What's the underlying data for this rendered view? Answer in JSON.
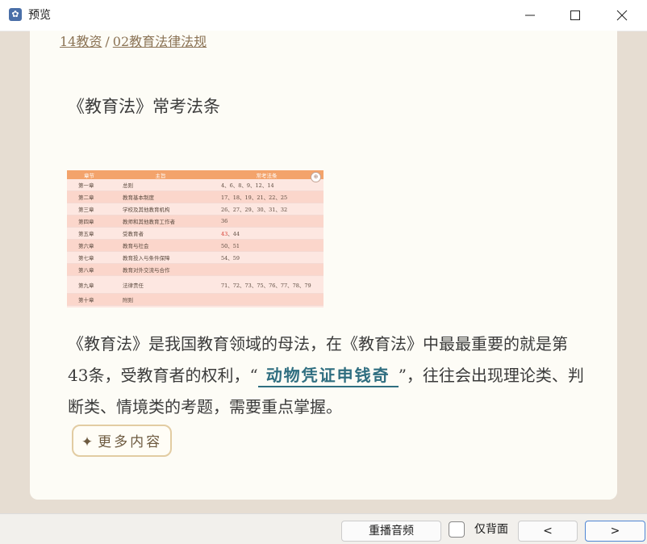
{
  "window": {
    "title": "预览",
    "icon": "app-icon"
  },
  "breadcrumb": {
    "parent": "14教资",
    "separator": "/",
    "current": "02教育法律法规"
  },
  "heading": "《教育法》常考法条",
  "table": {
    "headers": [
      "章节",
      "主旨",
      "常考法条"
    ],
    "rows": [
      {
        "chapter": "第一章",
        "topic": "总则",
        "articles": "4、6、8、9、12、14"
      },
      {
        "chapter": "第二章",
        "topic": "教育基本制度",
        "articles": "17、18、19、21、22、25"
      },
      {
        "chapter": "第三章",
        "topic": "学校及其他教育机构",
        "articles": "26、27、29、30、31、32"
      },
      {
        "chapter": "第四章",
        "topic": "教师和其他教育工作者",
        "articles": "36"
      },
      {
        "chapter": "第五章",
        "topic": "受教育者",
        "articles_highlight": "43",
        "articles_rest": "、44"
      },
      {
        "chapter": "第六章",
        "topic": "教育与社会",
        "articles": "50、51"
      },
      {
        "chapter": "第七章",
        "topic": "教育投入与条件保障",
        "articles": "54、59"
      },
      {
        "chapter": "第八章",
        "topic": "教育对外交流与合作",
        "articles": ""
      },
      {
        "chapter": "第九章",
        "topic": "法律责任",
        "articles": "71、72、73、75、76、77、78、79"
      },
      {
        "chapter": "第十章",
        "topic": "附则",
        "articles": ""
      }
    ],
    "colors": {
      "header": "#f3a36b",
      "highlight": "#d63a2f"
    }
  },
  "paragraph": {
    "before": "《教育法》是我国教育领域的母法，在《教育法》中最最重要的就是第43条，受教育者的权利，“",
    "blank": "动物凭证申钱奇",
    "after": "”，往往会出现理论类、判断类、情境类的考题，需要重点掌握。"
  },
  "more_button": {
    "icon": "sparkle-icon",
    "glyph": "✦",
    "label": "更多内容"
  },
  "bottom_bar": {
    "replay_label": "重播音频",
    "back_only_label": "仅背面",
    "back_only_checked": false,
    "prev_label": "<",
    "next_label": ">"
  }
}
